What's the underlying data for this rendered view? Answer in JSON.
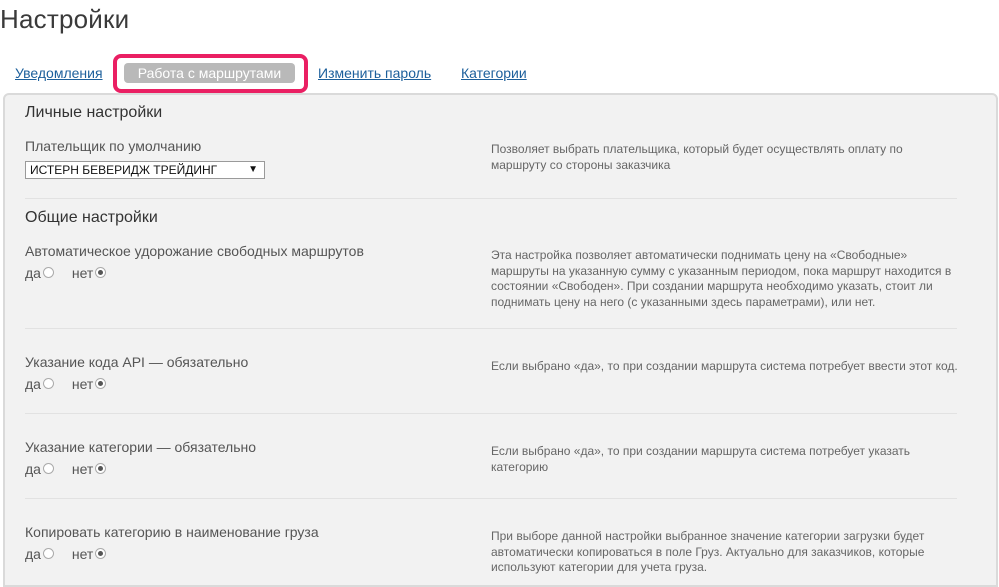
{
  "page": {
    "title": "Настройки"
  },
  "tabs": [
    {
      "label": "Уведомления"
    },
    {
      "label": "Работа с маршрутами"
    },
    {
      "label": "Изменить пароль"
    },
    {
      "label": "Категории"
    }
  ],
  "active_tab": "Работа с маршрутами",
  "personal": {
    "title": "Личные настройки",
    "payer_label": "Плательщик по умолчанию",
    "payer_value": "ИСТЕРН БЕВЕРИДЖ ТРЕЙДИНГ",
    "payer_desc": "Позволяет выбрать плательщика, который будет осуществлять оплату по маршруту со стороны заказчика"
  },
  "general": {
    "title": "Общие настройки",
    "yes": "да",
    "no": "нет",
    "settings": [
      {
        "label": "Автоматическое удорожание свободных маршрутов",
        "desc": "Эта настройка позволяет автоматически поднимать цену на «Свободные» маршруты на указанную сумму с указанным периодом, пока маршрут находится в состоянии «Свободен». При создании маршрута необходимо указать, стоит ли поднимать цену на него (с указанными здесь параметрами), или нет.",
        "selected": "нет"
      },
      {
        "label": "Указание кода API — обязательно",
        "desc": "Если выбрано «да», то при создании маршрута система потребует ввести этот код.",
        "selected": "нет"
      },
      {
        "label": "Указание категории — обязательно",
        "desc": "Если выбрано «да», то при создании маршрута система потребует указать категорию",
        "selected": "нет"
      },
      {
        "label": "Копировать категорию в наименование груза",
        "desc": "При выборе данной настройки выбранное значение категории загрузки будет автоматически копироваться в поле Груз. Актуально для заказчиков, которые используют категории для учета груза.",
        "selected": "нет"
      }
    ]
  },
  "colors": {
    "accent": "#ea1f63",
    "link": "#1c5f9b",
    "panel": "#f2f2f2"
  }
}
